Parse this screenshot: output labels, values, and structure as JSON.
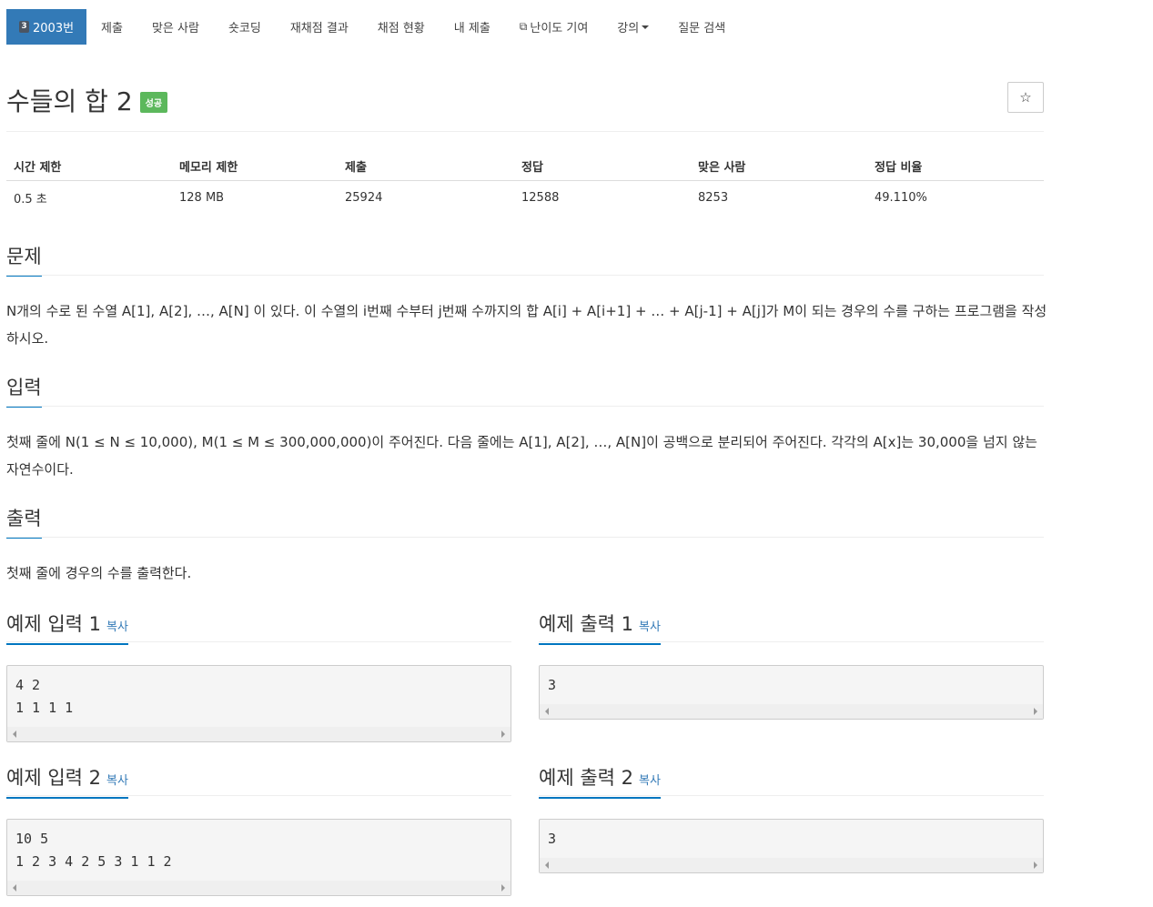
{
  "nav": {
    "tier_digit": "3",
    "active": "2003번",
    "items": [
      "제출",
      "맞은 사람",
      "숏코딩",
      "재채점 결과",
      "채점 현황",
      "내 제출",
      "난이도 기여",
      "강의",
      "질문 검색"
    ]
  },
  "problem": {
    "title": "수들의 합 2",
    "status_badge": "성공",
    "star_icon": "☆"
  },
  "info_table": {
    "headers": [
      "시간 제한",
      "메모리 제한",
      "제출",
      "정답",
      "맞은 사람",
      "정답 비율"
    ],
    "values": [
      "0.5 초",
      "128 MB",
      "25924",
      "12588",
      "8253",
      "49.110%"
    ]
  },
  "sections": {
    "problem": {
      "heading": "문제",
      "text": "N개의 수로 된 수열 A[1], A[2], …, A[N] 이 있다. 이 수열의 i번째 수부터 j번째 수까지의 합 A[i] + A[i+1] + … + A[j-1] + A[j]가 M이 되는 경우의 수를 구하는 프로그램을 작성하시오."
    },
    "input": {
      "heading": "입력",
      "text": "첫째 줄에 N(1 ≤ N ≤ 10,000), M(1 ≤ M ≤ 300,000,000)이 주어진다. 다음 줄에는 A[1], A[2], …, A[N]이 공백으로 분리되어 주어진다. 각각의 A[x]는 30,000을 넘지 않는 자연수이다."
    },
    "output": {
      "heading": "출력",
      "text": "첫째 줄에 경우의 수를 출력한다."
    }
  },
  "samples": {
    "copy_label": "복사",
    "in1_title": "예제 입력 1",
    "out1_title": "예제 출력 1",
    "in2_title": "예제 입력 2",
    "out2_title": "예제 출력 2",
    "in1": "4 2\n1 1 1 1",
    "out1": "3",
    "in2": "10 5\n1 2 3 4 2 5 3 1 1 2",
    "out2": "3"
  }
}
